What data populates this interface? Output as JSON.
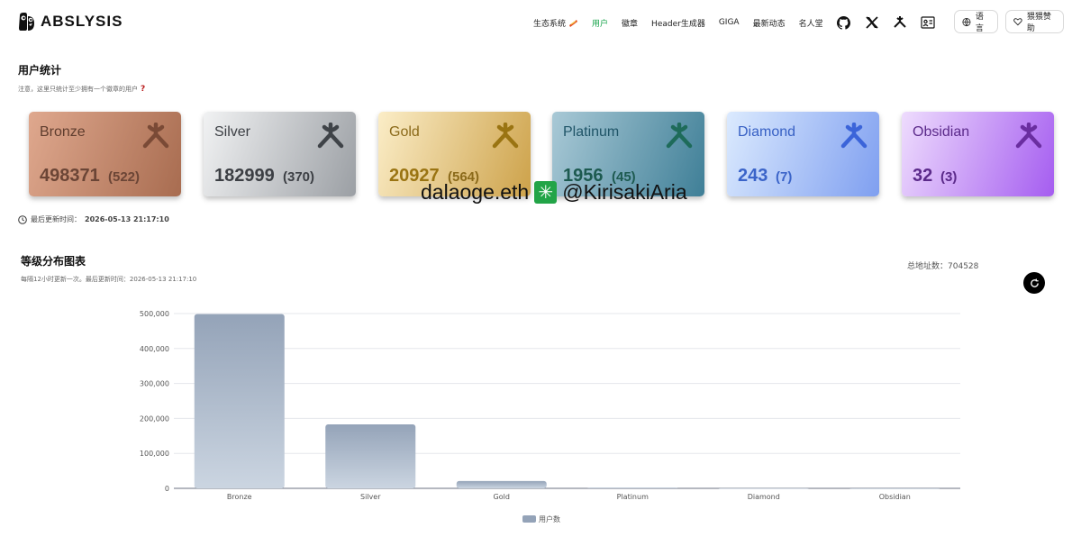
{
  "brand": {
    "name": "ABSLYSIS"
  },
  "nav": {
    "items": [
      {
        "label": "生态系统",
        "active": false,
        "badge": "�among"
      },
      {
        "label": "用户",
        "active": true
      },
      {
        "label": "徽章",
        "active": false
      },
      {
        "label": "Header生成器",
        "active": false
      },
      {
        "label": "GIGA",
        "active": false
      },
      {
        "label": "最新动态",
        "active": false
      },
      {
        "label": "名人堂",
        "active": false
      }
    ],
    "icons": [
      "github-icon",
      "x-icon",
      "abstract-icon",
      "id-card-icon"
    ],
    "language_label": "语言",
    "donate_label": "猥猥赞助"
  },
  "stats": {
    "title": "用户统计",
    "note": "注意，这里只统计至少拥有一个徽章的用户",
    "updated_label": "最后更新时间：",
    "updated_time": "2026-05-13 21:17:10",
    "tiers": [
      {
        "name": "Bronze",
        "count": "498371",
        "sub": "(522)",
        "gradient": [
          "#dfa88e",
          "#a86c50"
        ],
        "name_color": "#5f3d2e",
        "count_color": "#6b4536",
        "sub_color": "#6b4536",
        "logo_color": "#7a4a36"
      },
      {
        "name": "Silver",
        "count": "182999",
        "sub": "(370)",
        "gradient": [
          "#f1f2f3",
          "#9b9fa4"
        ],
        "name_color": "#3c3f44",
        "count_color": "#3c3f44",
        "sub_color": "#3c3f44",
        "logo_color": "#3f4348"
      },
      {
        "name": "Gold",
        "count": "20927",
        "sub": "(564)",
        "gradient": [
          "#fbedc7",
          "#cda24a"
        ],
        "name_color": "#8b6a1a",
        "count_color": "#9a7412",
        "sub_color": "#8b6a1a",
        "logo_color": "#9a7412"
      },
      {
        "name": "Platinum",
        "count": "1956",
        "sub": "(45)",
        "gradient": [
          "#a9c9d6",
          "#3f7f97"
        ],
        "name_color": "#205568",
        "count_color": "#1d5a50",
        "sub_color": "#1d5a50",
        "logo_color": "#1e6b5a"
      },
      {
        "name": "Diamond",
        "count": "243",
        "sub": "(7)",
        "gradient": [
          "#dbeafe",
          "#7f9ff0"
        ],
        "name_color": "#3760c4",
        "count_color": "#3b64c9",
        "sub_color": "#3b64c9",
        "logo_color": "#3b64d9"
      },
      {
        "name": "Obsidian",
        "count": "32",
        "sub": "(3)",
        "gradient": [
          "#eedcfd",
          "#a55df0"
        ],
        "name_color": "#5b2a8a",
        "count_color": "#5b2a8a",
        "sub_color": "#5b2a8a",
        "logo_color": "#6a2ea0"
      }
    ]
  },
  "watermark": {
    "left": "dalaoge.eth",
    "right": "@KirisakiAria"
  },
  "distribution": {
    "title": "等级分布图表",
    "subtitle": "每隔12小时更新一次。最后更新时间：2026-05-13 21:17:10",
    "total_label": "总地址数：",
    "total_value": "704528"
  },
  "chart_data": {
    "type": "bar",
    "categories": [
      "Bronze",
      "Silver",
      "Gold",
      "Platinum",
      "Diamond",
      "Obsidian"
    ],
    "series": [
      {
        "name": "用户数",
        "values": [
          498371,
          182999,
          20927,
          1956,
          243,
          32
        ]
      }
    ],
    "yticks": [
      "0",
      "100,000",
      "200,000",
      "300,000",
      "400,000",
      "500,000"
    ],
    "ylim": [
      0,
      500000
    ],
    "grid": true,
    "legend": "bottom-center",
    "bar_gradient": [
      "#94a3b8",
      "#cbd5e1"
    ]
  }
}
